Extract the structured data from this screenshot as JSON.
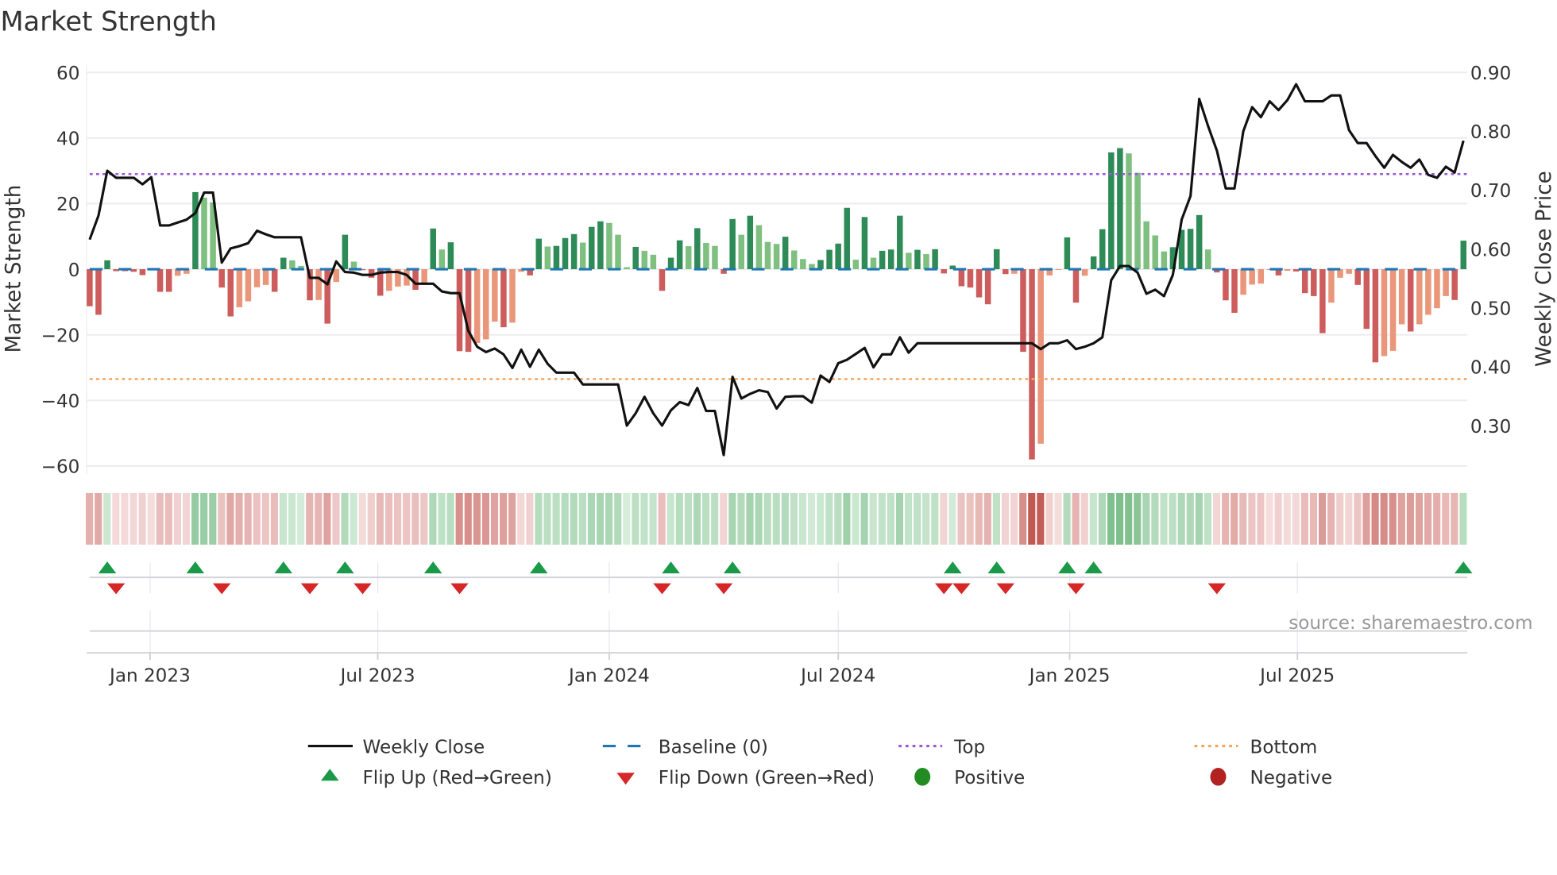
{
  "title": "Market Strength",
  "source": "source: sharemaestro.com",
  "colors": {
    "pos_strong": "#2e8b57",
    "pos_weak": "#7fbf7f",
    "neg_strong": "#cd5c5c",
    "neg_weak": "#e9967a",
    "baseline": "#1f77b4",
    "top": "#9b59d6",
    "bottom": "#f4a460",
    "price": "#111111",
    "flip_up": "#1a9a48",
    "flip_down": "#d62728",
    "positive": "#228b22",
    "negative": "#b22222"
  },
  "legend": {
    "weekly_close": "Weekly Close",
    "baseline": "Baseline (0)",
    "top": "Top",
    "bottom": "Bottom",
    "flip_up": "Flip Up (Red→Green)",
    "flip_down": "Flip Down (Green→Red)",
    "positive": "Positive",
    "negative": "Negative"
  },
  "chart_data": {
    "type": "bar",
    "title": "Market Strength",
    "ylabel": "Market Strength",
    "y2label": "Weekly Close Price",
    "ylim": [
      -62.5,
      62.4
    ],
    "y2lim": [
      0.2175,
      0.9135
    ],
    "grid": true,
    "legend_position": "bottom",
    "x_start_week": "2022-11-14",
    "x_frequency": "weekly",
    "top_level": 29,
    "bottom_level": -33.5,
    "baseline": 0,
    "y_ticks": [
      {
        "v": 60,
        "label": "60"
      },
      {
        "v": 40,
        "label": "40"
      },
      {
        "v": 20,
        "label": "20"
      },
      {
        "v": 0,
        "label": "0"
      },
      {
        "v": -20,
        "label": "−20"
      },
      {
        "v": -40,
        "label": "−40"
      },
      {
        "v": -60,
        "label": "−60"
      }
    ],
    "y2_ticks": [
      {
        "v": 0.9,
        "label": "0.90"
      },
      {
        "v": 0.8,
        "label": "0.80"
      },
      {
        "v": 0.7,
        "label": "0.70"
      },
      {
        "v": 0.6,
        "label": "0.60"
      },
      {
        "v": 0.5,
        "label": "0.50"
      },
      {
        "v": 0.4,
        "label": "0.40"
      },
      {
        "v": 0.3,
        "label": "0.30"
      }
    ],
    "x_ticks": [
      {
        "date": "2023-01-01",
        "label": "Jan 2023"
      },
      {
        "date": "2023-07-01",
        "label": "Jul 2023"
      },
      {
        "date": "2024-01-01",
        "label": "Jan 2024"
      },
      {
        "date": "2024-07-01",
        "label": "Jul 2024"
      },
      {
        "date": "2025-01-01",
        "label": "Jan 2025"
      },
      {
        "date": "2025-07-01",
        "label": "Jul 2025"
      }
    ],
    "series": [
      {
        "name": "Market Strength",
        "type": "bar",
        "values": [
          -11.3,
          -13.9,
          2.7,
          -0.6,
          -0.6,
          -0.8,
          -1.8,
          -0.2,
          -6.9,
          -6.9,
          -2.0,
          -1.4,
          23.5,
          21.8,
          20.4,
          -5.6,
          -14.4,
          -11.6,
          -9.8,
          -5.5,
          -4.8,
          -6.9,
          3.5,
          2.7,
          1.0,
          -9.5,
          -9.4,
          -16.6,
          -3.9,
          10.5,
          2.3,
          -0.3,
          -2.6,
          -8.1,
          -6.6,
          -5.3,
          -5.0,
          -6.3,
          -4.2,
          12.4,
          6.0,
          8.2,
          -25.0,
          -25.2,
          -22.5,
          -21.4,
          -16.0,
          -17.7,
          -16.3,
          -0.8,
          -1.9,
          9.3,
          6.9,
          7.1,
          9.5,
          10.7,
          8.1,
          12.9,
          14.6,
          14.1,
          10.5,
          0.6,
          6.8,
          5.6,
          4.4,
          -6.6,
          3.5,
          8.8,
          7.0,
          12.5,
          8.0,
          7.1,
          -1.4,
          15.3,
          10.5,
          16.3,
          13.4,
          8.3,
          7.7,
          9.9,
          5.7,
          3.1,
          1.6,
          2.8,
          5.9,
          7.8,
          18.7,
          2.9,
          15.9,
          3.5,
          5.6,
          6.0,
          16.3,
          5.0,
          5.9,
          4.6,
          6.1,
          -1.3,
          1.1,
          -5.2,
          -5.6,
          -8.6,
          -10.7,
          6.1,
          -1.5,
          -1.4,
          -25.2,
          -58.0,
          -53.2,
          -1.9,
          -0.2,
          9.7,
          -10.2,
          -2.0,
          3.9,
          12.2,
          35.6,
          36.9,
          35.3,
          29.4,
          14.6,
          10.3,
          5.4,
          6.7,
          12.0,
          12.3,
          16.5,
          6.0,
          -1.0,
          -9.5,
          -13.3,
          -7.8,
          -4.7,
          -4.4,
          -0.2,
          -1.9,
          -0.5,
          -0.7,
          -7.3,
          -8.2,
          -19.5,
          -10.2,
          -2.6,
          -1.4,
          -4.8,
          -18.2,
          -28.4,
          -26.5,
          -24.9,
          -16.8,
          -19.0,
          -16.8,
          -13.9,
          -11.9,
          -8.2,
          -9.4,
          8.7
        ]
      },
      {
        "name": "Weekly Close",
        "type": "line",
        "axis": "right",
        "values": [
          0.616,
          0.657,
          0.733,
          0.721,
          0.721,
          0.721,
          0.71,
          0.722,
          0.64,
          0.64,
          0.645,
          0.65,
          0.661,
          0.696,
          0.696,
          0.577,
          0.601,
          0.605,
          0.61,
          0.631,
          0.625,
          0.62,
          0.62,
          0.62,
          0.62,
          0.551,
          0.551,
          0.54,
          0.579,
          0.561,
          0.56,
          0.556,
          0.556,
          0.56,
          0.561,
          0.561,
          0.556,
          0.541,
          0.541,
          0.541,
          0.528,
          0.525,
          0.525,
          0.461,
          0.434,
          0.425,
          0.431,
          0.421,
          0.398,
          0.429,
          0.4,
          0.429,
          0.405,
          0.39,
          0.39,
          0.39,
          0.37,
          0.37,
          0.37,
          0.37,
          0.37,
          0.3,
          0.321,
          0.349,
          0.321,
          0.3,
          0.326,
          0.34,
          0.335,
          0.364,
          0.325,
          0.325,
          0.25,
          0.383,
          0.346,
          0.354,
          0.36,
          0.357,
          0.329,
          0.349,
          0.35,
          0.35,
          0.339,
          0.385,
          0.374,
          0.406,
          0.412,
          0.422,
          0.432,
          0.399,
          0.421,
          0.421,
          0.45,
          0.424,
          0.44,
          0.44,
          0.44,
          0.44,
          0.44,
          0.44,
          0.44,
          0.44,
          0.44,
          0.44,
          0.44,
          0.44,
          0.44,
          0.44,
          0.43,
          0.44,
          0.44,
          0.445,
          0.43,
          0.434,
          0.44,
          0.45,
          0.547,
          0.571,
          0.571,
          0.56,
          0.524,
          0.531,
          0.52,
          0.556,
          0.65,
          0.69,
          0.855,
          0.809,
          0.767,
          0.703,
          0.703,
          0.8,
          0.841,
          0.824,
          0.851,
          0.836,
          0.853,
          0.88,
          0.851,
          0.851,
          0.851,
          0.861,
          0.861,
          0.802,
          0.78,
          0.78,
          0.758,
          0.738,
          0.76,
          0.748,
          0.738,
          0.752,
          0.726,
          0.721,
          0.74,
          0.73,
          0.784
        ]
      }
    ]
  }
}
